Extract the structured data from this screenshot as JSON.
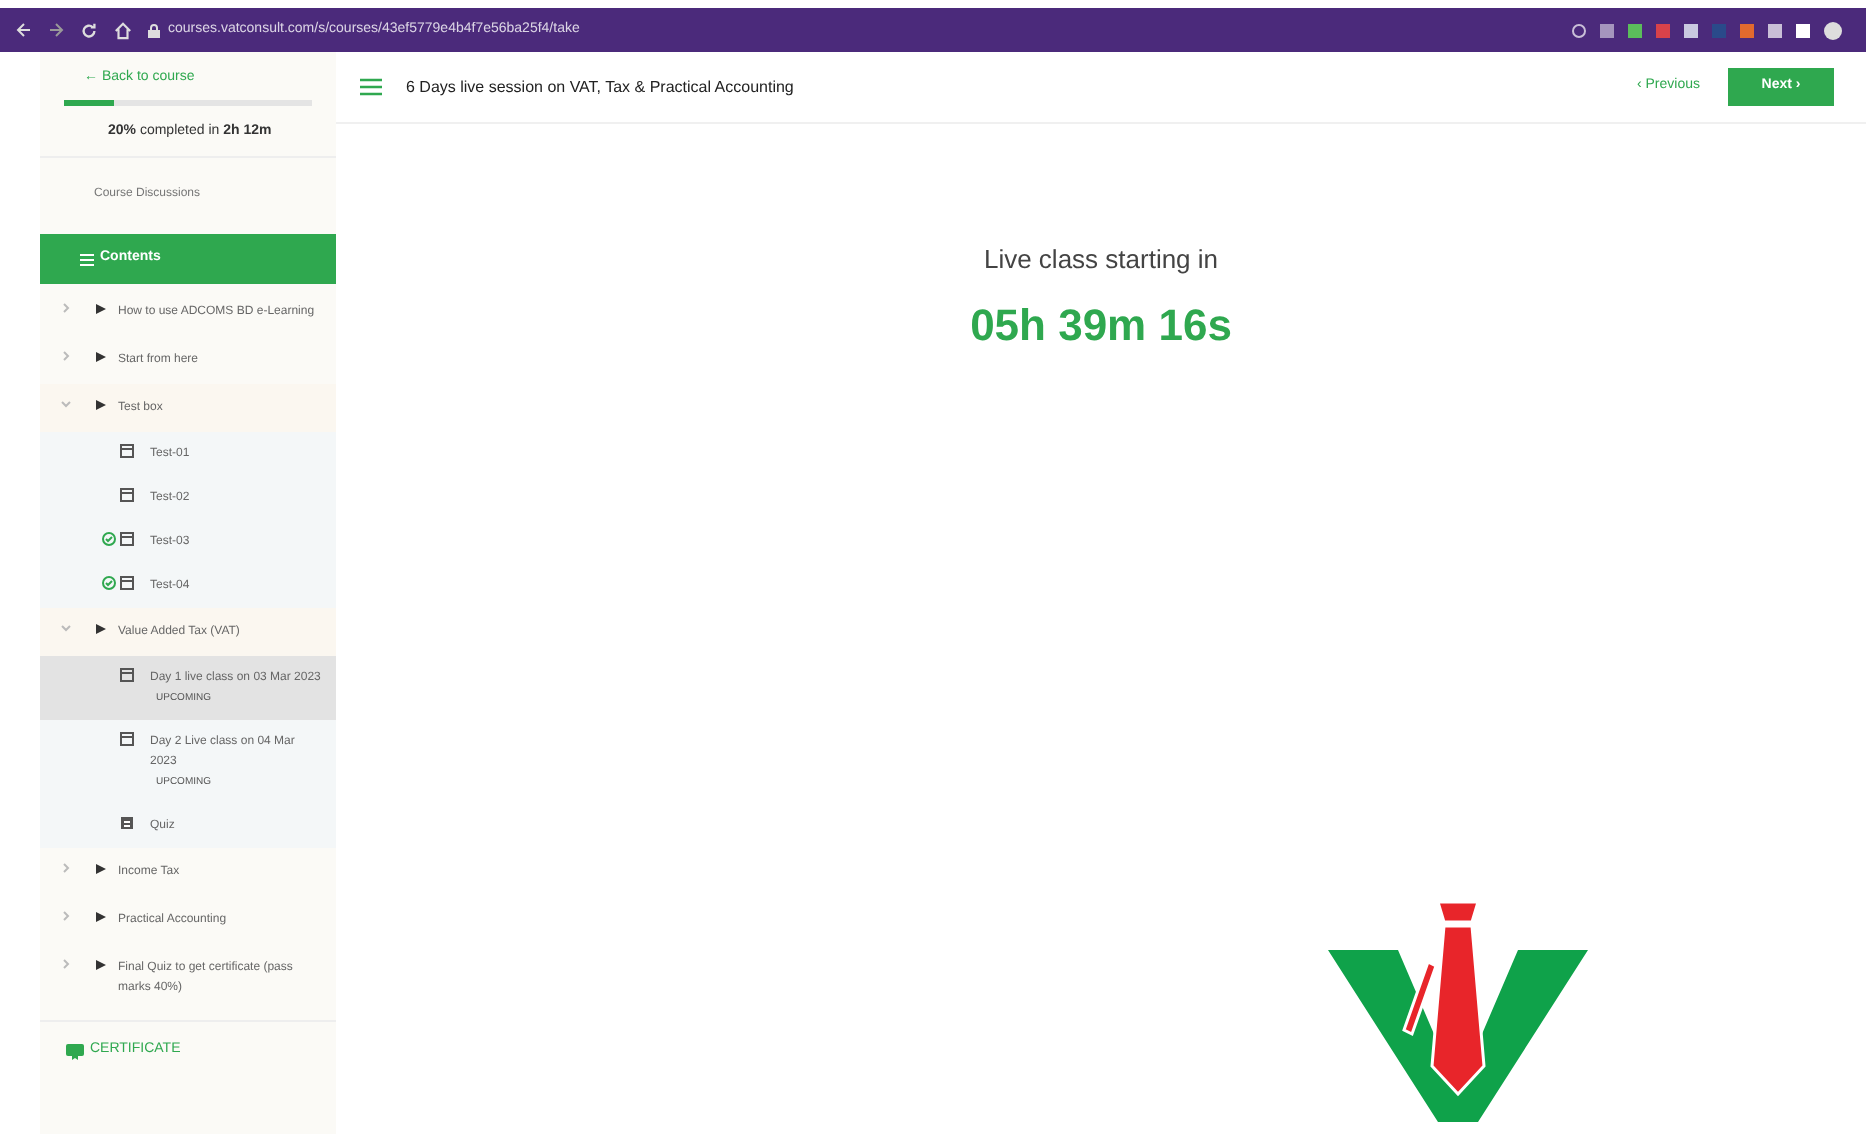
{
  "browser": {
    "url": "courses.vatconsult.com/s/courses/43ef5779e4b4f7e56ba25f4/take"
  },
  "sidebar": {
    "back_link": "← Back to course",
    "progress": {
      "level": 0.2,
      "text": "**20%** completed in **2h 12m**"
    },
    "discussions": "Course Discussions",
    "contents_header": "Contents",
    "tree": [
      {
        "kind": "section",
        "label": "How to use ADCOMS BD e-Learning",
        "expanded": false
      },
      {
        "kind": "section",
        "label": "Start from here",
        "expanded": false
      },
      {
        "kind": "section",
        "label": "Test box",
        "expanded": true,
        "children": [
          {
            "kind": "lesson",
            "label": "Test-01",
            "completed": false,
            "selected": false
          },
          {
            "kind": "lesson",
            "label": "Test-02",
            "completed": false,
            "selected": false
          },
          {
            "kind": "lesson",
            "label": "Test-03",
            "completed": true,
            "selected": false
          },
          {
            "kind": "lesson",
            "label": "Test-04",
            "completed": true,
            "selected": false
          }
        ]
      },
      {
        "kind": "section",
        "label": "Value Added Tax (VAT)",
        "expanded": true,
        "children": [
          {
            "kind": "lesson",
            "label": "Day 1 live class on 03 Mar 2023",
            "badge": "UPCOMING",
            "completed": false,
            "selected": true
          },
          {
            "kind": "lesson",
            "label": "Day 2 Live class on 04 Mar 2023",
            "badge": "UPCOMING",
            "completed": false,
            "selected": false
          },
          {
            "kind": "quiz",
            "label": "Quiz",
            "completed": false,
            "selected": false
          }
        ]
      },
      {
        "kind": "section",
        "label": "Income Tax",
        "expanded": false
      },
      {
        "kind": "section",
        "label": "Practical Accounting",
        "expanded": false
      },
      {
        "kind": "section",
        "label": "Final Quiz to get certificate (pass marks 40%)",
        "expanded": false
      }
    ],
    "certificate": "CERTIFICATE"
  },
  "header": {
    "title": "6 Days live session on VAT, Tax & Practical Accounting",
    "previous": "‹ Previous",
    "next": "Next ›"
  },
  "main": {
    "caption": "Live class starting in",
    "countdown": "05h 39m 16s"
  }
}
